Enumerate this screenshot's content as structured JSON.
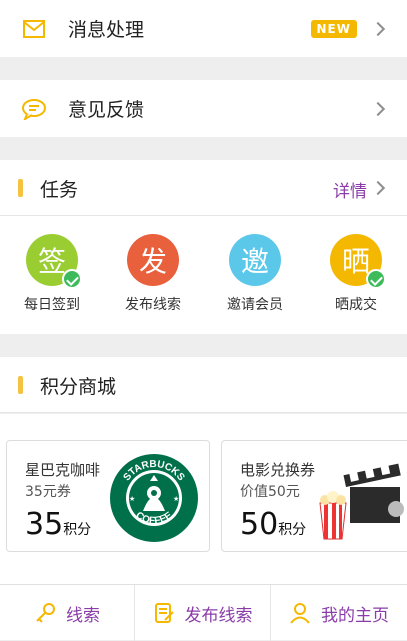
{
  "menu": {
    "messages": {
      "label": "消息处理",
      "badge": "NEW",
      "icon": "envelope-icon"
    },
    "feedback": {
      "label": "意见反馈",
      "icon": "chat-bubble-icon"
    }
  },
  "tasks": {
    "title": "任务",
    "more": "详情",
    "items": [
      {
        "glyph": "签",
        "label": "每日签到",
        "color": "#9acd32",
        "done": true
      },
      {
        "glyph": "发",
        "label": "发布线索",
        "color": "#e8603c",
        "done": false
      },
      {
        "glyph": "邀",
        "label": "邀请会员",
        "color": "#5bc8ea",
        "done": false
      },
      {
        "glyph": "晒",
        "label": "晒成交",
        "color": "#f5b800",
        "done": true
      }
    ]
  },
  "shop": {
    "title": "积分商城",
    "cards": [
      {
        "name": "星巴克咖啡",
        "sub": "35元券",
        "points": "35",
        "unit": "积分",
        "logo_text_top": "STARBUCKS",
        "logo_text_bottom": "COFFEE",
        "icon": "starbucks-logo-icon"
      },
      {
        "name": "电影兑换券",
        "sub": "价值50元",
        "points": "50",
        "unit": "积分",
        "icon": "popcorn-clapperboard-icon"
      }
    ]
  },
  "tabbar": {
    "items": [
      {
        "label": "线索",
        "icon": "key-icon"
      },
      {
        "label": "发布线索",
        "icon": "edit-document-icon"
      },
      {
        "label": "我的主页",
        "icon": "user-icon"
      }
    ]
  },
  "colors": {
    "accent": "#8a3da8",
    "yellow": "#f5b800"
  }
}
